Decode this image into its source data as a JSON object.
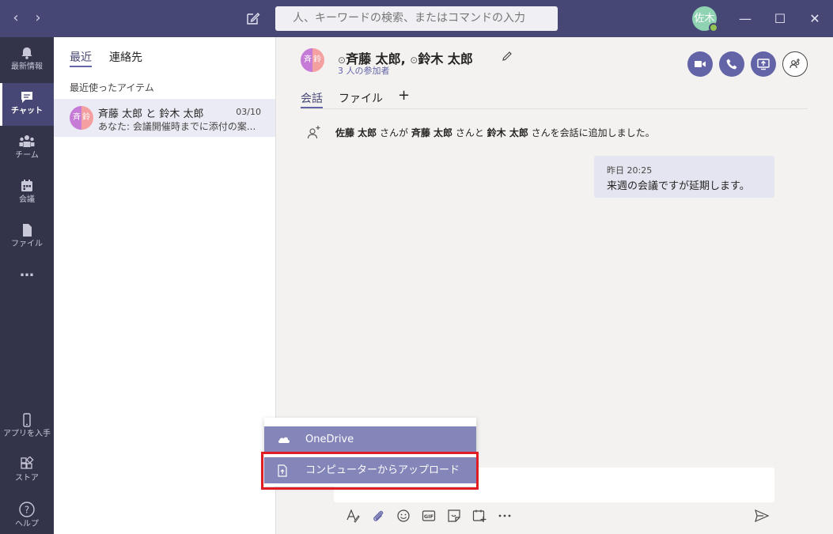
{
  "titlebar": {
    "search_placeholder": "人、キーワードの検索、またはコマンドの入力",
    "user_initials": "佐木",
    "win_minimize": "—",
    "win_maximize": "☐",
    "win_close": "✕"
  },
  "rail": {
    "items": [
      {
        "label": "最新情報",
        "icon": "bell-icon"
      },
      {
        "label": "チャット",
        "icon": "chat-icon"
      },
      {
        "label": "チーム",
        "icon": "teams-icon"
      },
      {
        "label": "会議",
        "icon": "calendar-icon"
      },
      {
        "label": "ファイル",
        "icon": "file-icon"
      },
      {
        "label": "…",
        "icon": "more-icon"
      }
    ],
    "bottom": [
      {
        "label": "アプリを入手",
        "icon": "phone-icon"
      },
      {
        "label": "ストア",
        "icon": "store-icon"
      },
      {
        "label": "ヘルプ",
        "icon": "help-icon"
      }
    ]
  },
  "list": {
    "tabs": [
      "最近",
      "連絡先"
    ],
    "section_title": "最近使ったアイテム",
    "chat": {
      "avatar_left": "斉",
      "avatar_right": "鈴",
      "name": "斉藤 太郎 と 鈴木 太郎",
      "date": "03/10",
      "preview": "あなた: 会議開催時までに添付の案..."
    }
  },
  "conversation": {
    "avatar_left": "斉",
    "avatar_right": "鈴",
    "person1": "斉藤 太郎,",
    "person2": "鈴木 太郎",
    "participants": "3 人の参加者",
    "tabs": [
      "会話",
      "ファイル",
      "+"
    ],
    "system_message": {
      "actor": "佐藤 太郎",
      "t1": " さんが ",
      "p1": "斉藤 太郎",
      "t2": " さんと ",
      "p2": "鈴木 太郎",
      "t3": " さんを会話に追加しました。"
    },
    "message": {
      "time": "昨日 20:25",
      "text": "来週の会議ですが延期します。"
    }
  },
  "attach_menu": {
    "items": [
      {
        "label": "OneDrive",
        "icon": "onedrive-icon"
      },
      {
        "label": "コンピューターからアップロード",
        "icon": "upload-icon"
      }
    ]
  },
  "colors": {
    "titlebar": "#464775",
    "rail": "#33344a",
    "accent": "#6264a7",
    "menu_item": "#8485b8",
    "highlight": "#e01d24"
  }
}
